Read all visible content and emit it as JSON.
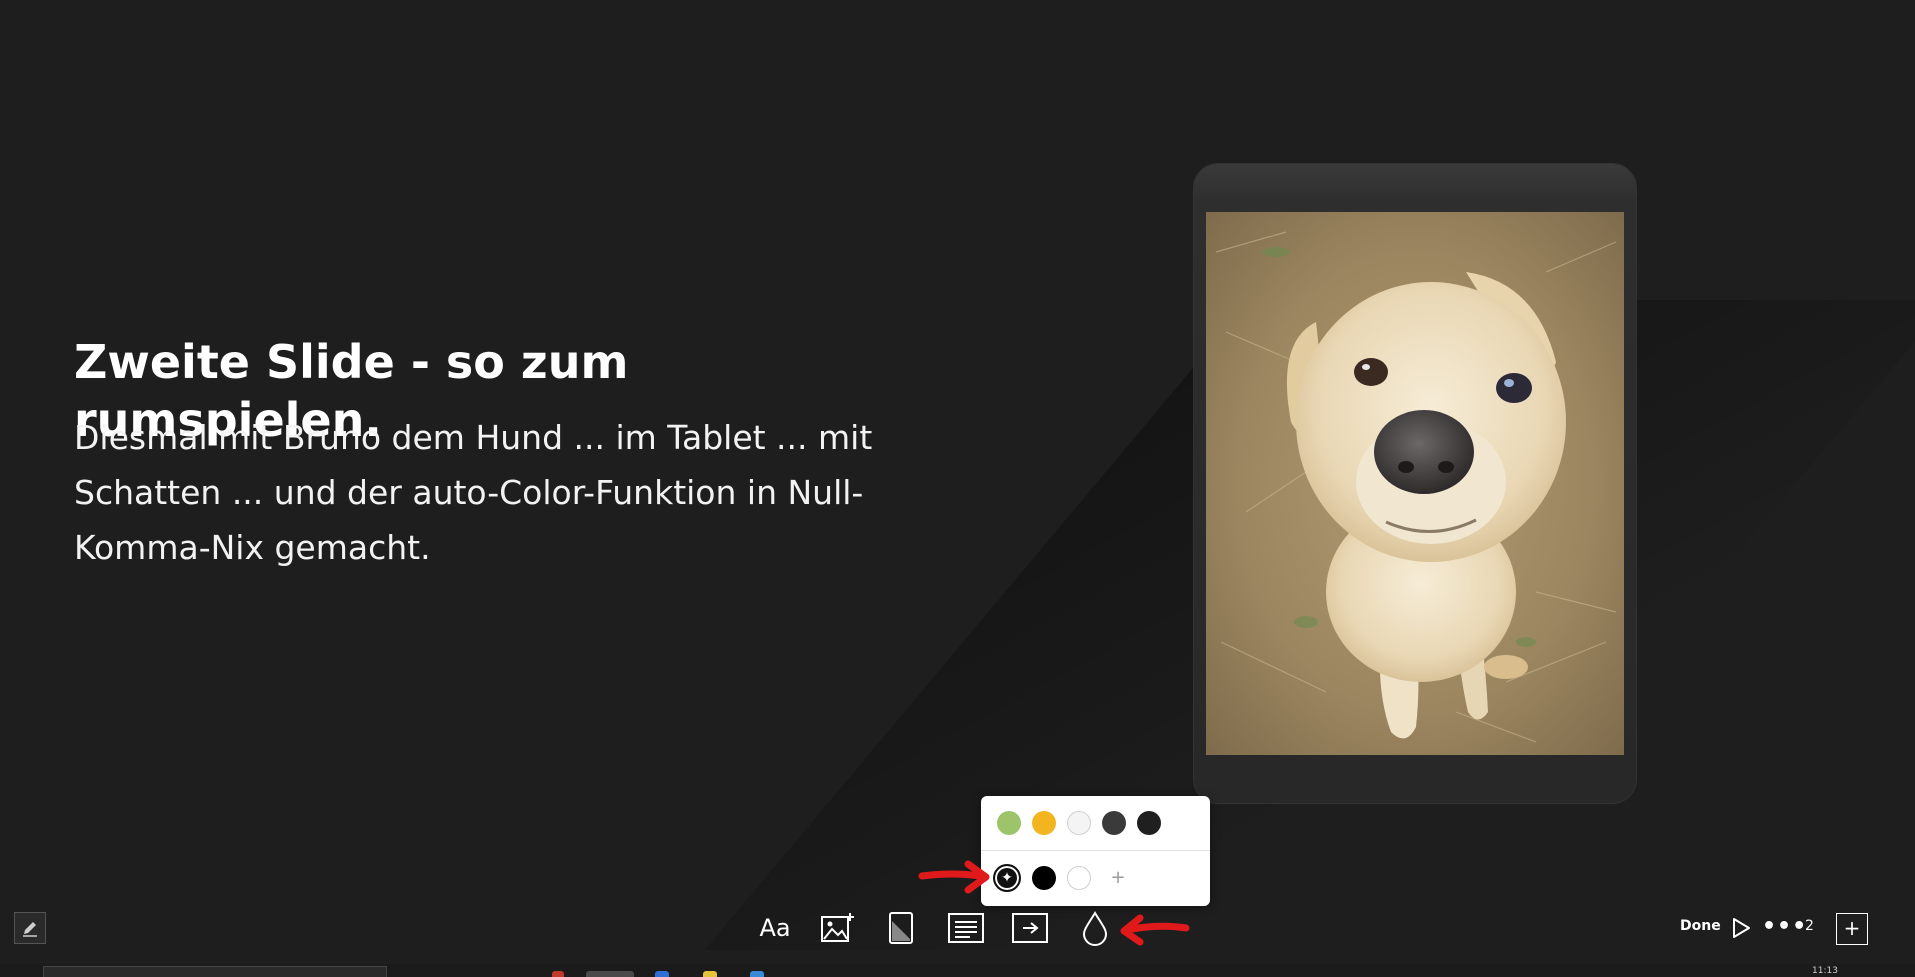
{
  "slide": {
    "title": "Zweite Slide - so zum rumspielen.",
    "body_lines": [
      "Diesmal mit Bruno dem Hund ... im Tablet ... mit",
      "Schatten ... und der auto-Color-Funktion in Null-",
      "Komma-Nix gemacht."
    ],
    "image_icon": "dog-photo"
  },
  "color_popover": {
    "theme_colors": [
      "#9dc46a",
      "#f3b51f",
      "#f4f4f4",
      "#3a3a3a",
      "#1f1f1f"
    ],
    "auto_icon": "sparkle-icon",
    "auto_symbol": "✦",
    "custom_colors": [
      "#000000",
      "#ffffff"
    ],
    "add_symbol": "+"
  },
  "toolbar": {
    "text_style_label": "Aa",
    "icons": [
      "text-style-icon",
      "insert-image-icon",
      "device-frame-icon",
      "text-layout-icon",
      "export-icon",
      "color-drop-icon"
    ],
    "done_label": "Done",
    "slide_number": "2",
    "add_slide_symbol": "+",
    "more_symbol": "•••"
  },
  "taskbar": {
    "clock": "11:13"
  },
  "colors": {
    "background": "#1e1e1e",
    "annotation_red": "#e0191b"
  }
}
